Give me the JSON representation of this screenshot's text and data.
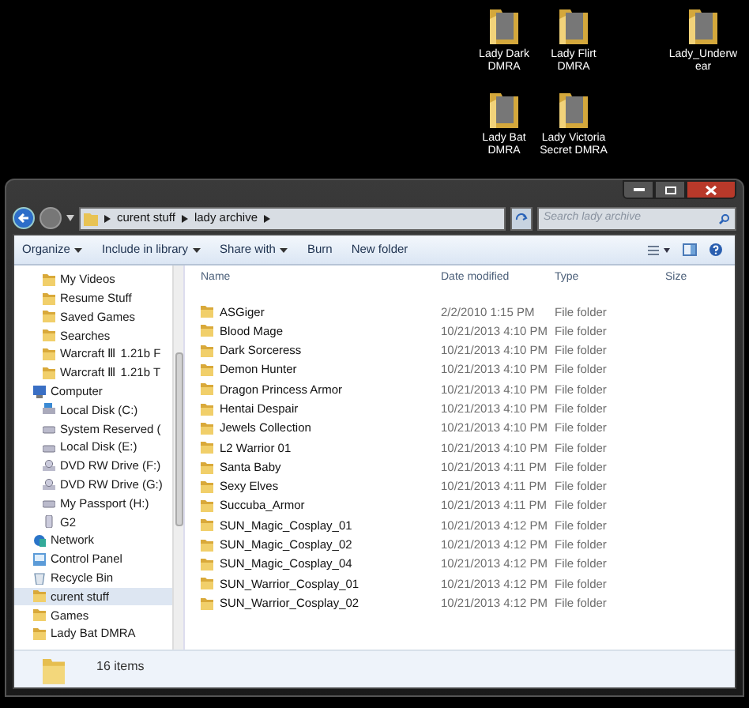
{
  "desktop_icons": [
    {
      "label": "Lady Dark DMRA"
    },
    {
      "label": "Lady Flirt DMRA"
    },
    {
      "label": "Lady_Underwear"
    },
    {
      "label": "Lady Bat DMRA"
    },
    {
      "label": "Lady Victoria Secret DMRA"
    }
  ],
  "window": {
    "address": [
      "curent stuff",
      "lady archive"
    ],
    "search": {
      "placeholder": "Search lady archive"
    },
    "toolbar": [
      {
        "label": "Organize",
        "dropdown": true
      },
      {
        "label": "Include in library",
        "dropdown": true
      },
      {
        "label": "Share with",
        "dropdown": true
      },
      {
        "label": "Burn",
        "dropdown": false
      },
      {
        "label": "New folder",
        "dropdown": false
      }
    ],
    "nav_pane": {
      "scrolled_items": [
        {
          "label": "My Videos"
        },
        {
          "label": "Resume Stuff"
        },
        {
          "label": "Saved Games"
        },
        {
          "label": "Searches"
        },
        {
          "label": "Warcraft Ⅲ 1.21b F"
        },
        {
          "label": "Warcraft Ⅲ 1.21b T"
        }
      ],
      "items": [
        {
          "label": "Computer",
          "kind": "computer",
          "selected": false,
          "children": [
            {
              "label": "Local Disk (C:)",
              "kind": "disk",
              "selected": false
            },
            {
              "label": "System Reserved (",
              "kind": "drive",
              "selected": false
            },
            {
              "label": "Local Disk (E:)",
              "kind": "drive",
              "selected": false
            },
            {
              "label": "DVD RW Drive (F:)",
              "kind": "dvd",
              "selected": false
            },
            {
              "label": "DVD RW Drive (G:)",
              "kind": "dvd",
              "selected": false
            },
            {
              "label": "My Passport (H:)",
              "kind": "drive",
              "selected": false
            },
            {
              "label": "G2",
              "kind": "device",
              "selected": false
            }
          ]
        },
        {
          "label": "Network",
          "kind": "network",
          "selected": false
        },
        {
          "label": "Control Panel",
          "kind": "panel",
          "selected": false
        },
        {
          "label": "Recycle Bin",
          "kind": "bin",
          "selected": false
        },
        {
          "label": "curent stuff",
          "kind": "folder",
          "selected": true
        },
        {
          "label": "Games",
          "kind": "folder",
          "selected": false
        },
        {
          "label": "Lady Bat DMRA",
          "kind": "folder",
          "selected": false
        }
      ]
    },
    "table": {
      "columns": [
        "Name",
        "Date modified",
        "Type",
        "Size"
      ],
      "rows": [
        [
          "ASGiger",
          "2/2/2010 1:15 PM",
          "File folder"
        ],
        [
          "Blood Mage",
          "10/21/2013 4:10 PM",
          "File folder"
        ],
        [
          "Dark Sorceress",
          "10/21/2013 4:10 PM",
          "File folder"
        ],
        [
          "Demon Hunter",
          "10/21/2013 4:10 PM",
          "File folder"
        ],
        [
          "Dragon Princess Armor",
          "10/21/2013 4:10 PM",
          "File folder"
        ],
        [
          "Hentai Despair",
          "10/21/2013 4:10 PM",
          "File folder"
        ],
        [
          "Jewels Collection",
          "10/21/2013 4:10 PM",
          "File folder"
        ],
        [
          "L2 Warrior 01",
          "10/21/2013 4:10 PM",
          "File folder"
        ],
        [
          "Santa Baby",
          "10/21/2013 4:11 PM",
          "File folder"
        ],
        [
          "Sexy Elves",
          "10/21/2013 4:11 PM",
          "File folder"
        ],
        [
          "Succuba_Armor",
          "10/21/2013 4:11 PM",
          "File folder"
        ],
        [
          "SUN_Magic_Cosplay_01",
          "10/21/2013 4:12 PM",
          "File folder"
        ],
        [
          "SUN_Magic_Cosplay_02",
          "10/21/2013 4:12 PM",
          "File folder"
        ],
        [
          "SUN_Magic_Cosplay_04",
          "10/21/2013 4:12 PM",
          "File folder"
        ],
        [
          "SUN_Warrior_Cosplay_01",
          "10/21/2013 4:12 PM",
          "File folder"
        ],
        [
          "SUN_Warrior_Cosplay_02",
          "10/21/2013 4:12 PM",
          "File folder"
        ]
      ]
    },
    "status_bar": {
      "count": "16 items"
    }
  }
}
